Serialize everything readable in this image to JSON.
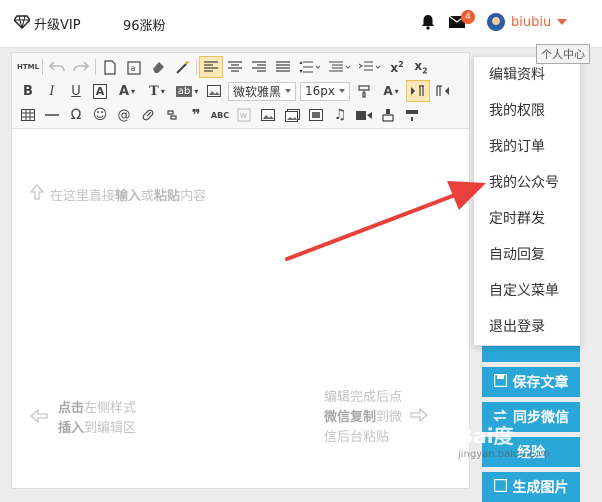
{
  "topbar": {
    "vip_label": "升级VIP",
    "fans_label": "96涨粉",
    "mail_badge": "4",
    "username": "biubiu",
    "tooltip": "个人中心"
  },
  "toolbar": {
    "html_label": "HTML",
    "font_family": "微软雅黑",
    "font_size": "16px"
  },
  "editor": {
    "placeholder_prefix": "在这里直接",
    "placeholder_b1": "输入",
    "placeholder_mid": "或",
    "placeholder_b2": "粘贴",
    "placeholder_suffix": "内容",
    "left_hint_b1": "点击",
    "left_hint_t1": "左侧样式",
    "left_hint_b2": "插入",
    "left_hint_t2": "到编辑区",
    "right_hint_line1": "编辑完成后点",
    "right_hint_b": "微信复制",
    "right_hint_t2": "到微",
    "right_hint_line3": "信后台粘贴"
  },
  "side_buttons": {
    "save": "保存文章",
    "sync": "同步微信",
    "exp": "经验",
    "gen": "生成图片"
  },
  "dropdown": {
    "items": [
      "编辑资料",
      "我的权限",
      "我的订单",
      "我的公众号",
      "定时群发",
      "自动回复",
      "自定义菜单",
      "退出登录"
    ]
  },
  "watermark": {
    "text": "Bai度",
    "url": "jingyan.baidu.com"
  },
  "colors": {
    "accent": "#2aa6d8",
    "username": "#e8663a",
    "arrow": "#e8403a",
    "badge": "#f25c2e"
  }
}
